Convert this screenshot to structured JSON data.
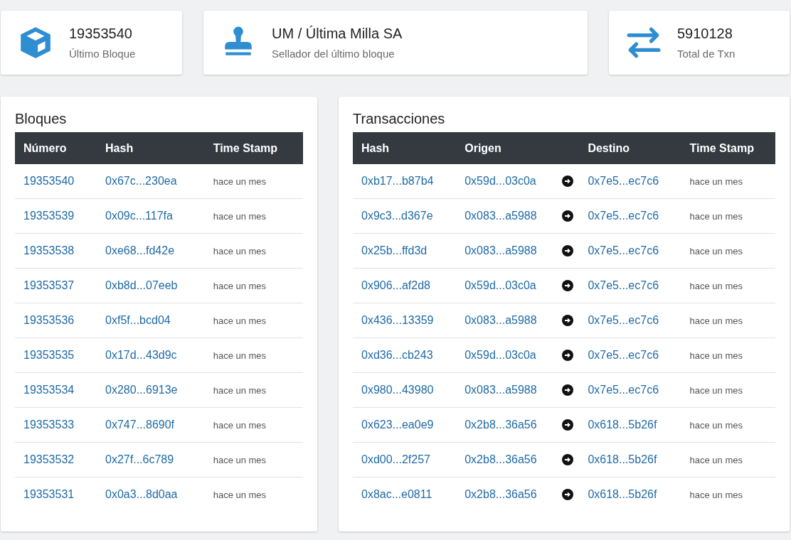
{
  "stats": [
    {
      "kind": "block",
      "value": "19353540",
      "label": "Último Bloque"
    },
    {
      "kind": "sealer",
      "value": "UM / Última Milla SA",
      "label": "Sellador del último bloque"
    },
    {
      "kind": "txn",
      "value": "5910128",
      "label": "Total de Txn"
    }
  ],
  "blocks": {
    "title": "Bloques",
    "columns": [
      "Número",
      "Hash",
      "Time Stamp"
    ],
    "rows": [
      [
        "19353540",
        "0x67c...230ea",
        "hace un mes"
      ],
      [
        "19353539",
        "0x09c...117fa",
        "hace un mes"
      ],
      [
        "19353538",
        "0xe68...fd42e",
        "hace un mes"
      ],
      [
        "19353537",
        "0xb8d...07eeb",
        "hace un mes"
      ],
      [
        "19353536",
        "0xf5f...bcd04",
        "hace un mes"
      ],
      [
        "19353535",
        "0x17d...43d9c",
        "hace un mes"
      ],
      [
        "19353534",
        "0x280...6913e",
        "hace un mes"
      ],
      [
        "19353533",
        "0x747...8690f",
        "hace un mes"
      ],
      [
        "19353532",
        "0x27f...6c789",
        "hace un mes"
      ],
      [
        "19353531",
        "0x0a3...8d0aa",
        "hace un mes"
      ]
    ]
  },
  "transactions": {
    "title": "Transacciones",
    "columns": [
      "Hash",
      "Origen",
      "Destino",
      "Time Stamp"
    ],
    "rows": [
      [
        "0xb17...b87b4",
        "0x59d...03c0a",
        "0x7e5...ec7c6",
        "hace un mes"
      ],
      [
        "0x9c3...d367e",
        "0x083...a5988",
        "0x7e5...ec7c6",
        "hace un mes"
      ],
      [
        "0x25b...ffd3d",
        "0x083...a5988",
        "0x7e5...ec7c6",
        "hace un mes"
      ],
      [
        "0x906...af2d8",
        "0x59d...03c0a",
        "0x7e5...ec7c6",
        "hace un mes"
      ],
      [
        "0x436...13359",
        "0x083...a5988",
        "0x7e5...ec7c6",
        "hace un mes"
      ],
      [
        "0xd36...cb243",
        "0x59d...03c0a",
        "0x7e5...ec7c6",
        "hace un mes"
      ],
      [
        "0x980...43980",
        "0x083...a5988",
        "0x7e5...ec7c6",
        "hace un mes"
      ],
      [
        "0x623...ea0e9",
        "0x2b8...36a56",
        "0x618...5b26f",
        "hace un mes"
      ],
      [
        "0xd00...2f257",
        "0x2b8...36a56",
        "0x618...5b26f",
        "hace un mes"
      ],
      [
        "0x8ac...e0811",
        "0x2b8...36a56",
        "0x618...5b26f",
        "hace un mes"
      ]
    ]
  }
}
